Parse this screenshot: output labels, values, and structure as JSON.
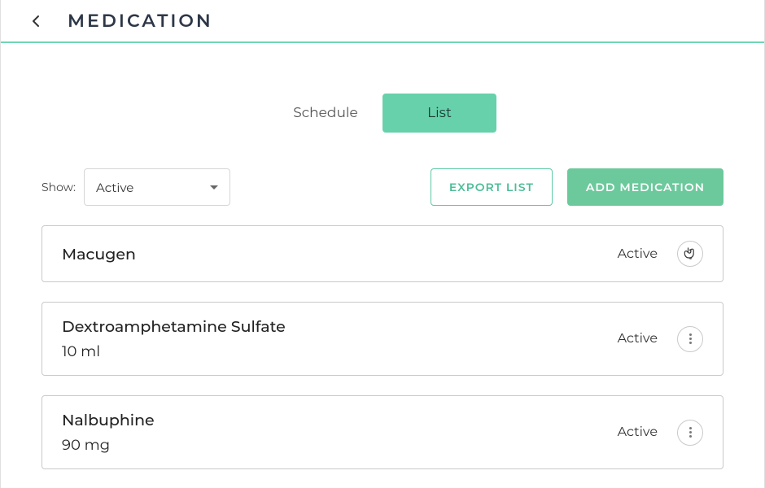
{
  "header": {
    "title": "MEDICATION"
  },
  "tabs": {
    "schedule": "Schedule",
    "list": "List"
  },
  "filter": {
    "show_label": "Show:",
    "selected": "Active"
  },
  "actions": {
    "export": "EXPORT LIST",
    "add": "ADD MEDICATION"
  },
  "medications": [
    {
      "name": "Macugen",
      "dose": "",
      "status": "Active"
    },
    {
      "name": "Dextroamphetamine Sulfate",
      "dose": "10 ml",
      "status": "Active"
    },
    {
      "name": "Nalbuphine",
      "dose": "90 mg",
      "status": "Active"
    }
  ]
}
